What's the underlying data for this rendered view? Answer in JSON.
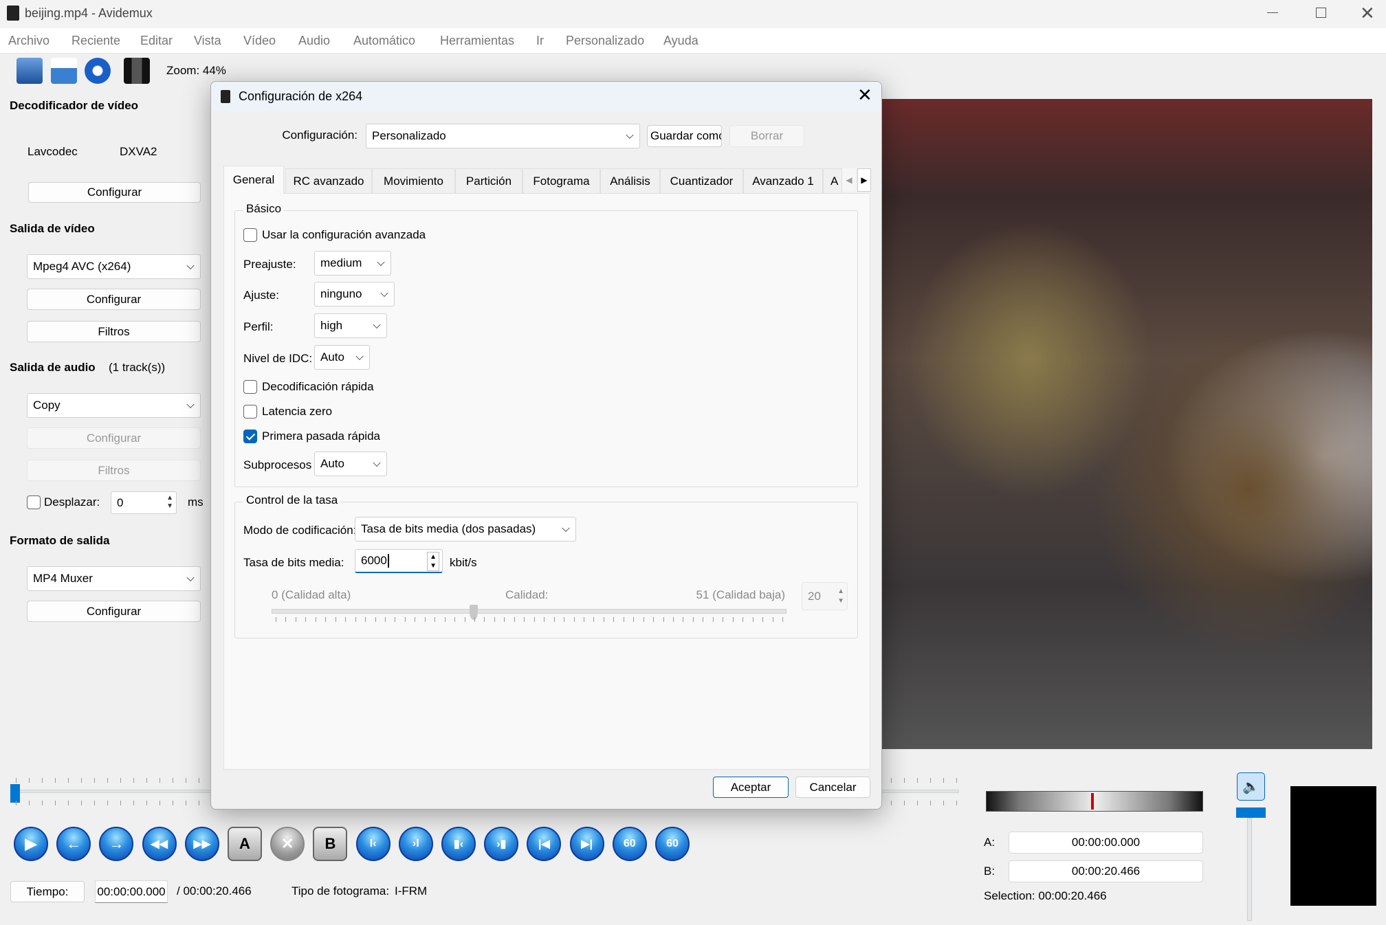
{
  "window": {
    "title": "beijing.mp4 - Avidemux"
  },
  "menu": [
    "Archivo",
    "Reciente",
    "Editar",
    "Vista",
    "Vídeo",
    "Audio",
    "Automático",
    "Herramientas",
    "Ir",
    "Personalizado",
    "Ayuda"
  ],
  "toolbar": {
    "zoom": "Zoom: 44%",
    "icons": [
      "open-file-icon",
      "save-file-icon",
      "info-icon",
      "filter-film-icon"
    ]
  },
  "left": {
    "video_decoder": {
      "title": "Decodificador de vídeo",
      "decoder": "Lavcodec",
      "accel": "DXVA2",
      "configure": "Configurar"
    },
    "video_output": {
      "title": "Salida de vídeo",
      "codec": "Mpeg4 AVC (x264)",
      "configure": "Configurar",
      "filters": "Filtros"
    },
    "audio_output": {
      "title": "Salida de audio",
      "tracks": "(1 track(s))",
      "codec": "Copy",
      "configure": "Configurar",
      "filters": "Filtros",
      "shift_label": "Desplazar:",
      "shift_value": "0",
      "shift_unit": "ms",
      "shift_checked": false
    },
    "output_format": {
      "title": "Formato de salida",
      "muxer": "MP4 Muxer",
      "configure": "Configurar"
    }
  },
  "dialog": {
    "title": "Configuración de x264",
    "config_label": "Configuración:",
    "config_value": "Personalizado",
    "save_as": "Guardar comc",
    "delete": "Borrar",
    "tabs": [
      "General",
      "RC avanzado",
      "Movimiento",
      "Partición",
      "Fotograma",
      "Análisis",
      "Cuantizador",
      "Avanzado 1",
      "A"
    ],
    "active_tab": "General",
    "basic": {
      "legend": "Básico",
      "use_advanced": "Usar la configuración avanzada",
      "preset_label": "Preajuste:",
      "preset": "medium",
      "tune_label": "Ajuste:",
      "tune": "ninguno",
      "profile_label": "Perfil:",
      "profile": "high",
      "idc_label": "Nivel de IDC:",
      "idc": "Auto",
      "fast_decode": "Decodificación rápida",
      "zero_latency": "Latencia zero",
      "fast_first_pass": "Primera pasada rápida",
      "threads_label": "Subprocesos",
      "threads": "Auto",
      "checks": {
        "use_advanced": false,
        "fast_decode": false,
        "zero_latency": false,
        "fast_first_pass": true
      }
    },
    "rate": {
      "legend": "Control de la tasa",
      "mode_label": "Modo de codificación:",
      "mode": "Tasa de bits media (dos pasadas)",
      "bitrate_label": "Tasa de bits media:",
      "bitrate": "6000",
      "bitrate_unit": "kbit/s",
      "q_min_label": "0 (Calidad alta)",
      "q_label": "Calidad:",
      "q_max_label": "51 (Calidad baja)",
      "quality": 20,
      "quality_display": "20",
      "quality_min": 0,
      "quality_max": 51
    },
    "ok": "Aceptar",
    "cancel": "Cancelar"
  },
  "bottom": {
    "time_button": "Tiempo:",
    "time": "00:00:00.000",
    "duration": "/ 00:00:20.466",
    "frame_type_label": "Tipo de fotograma:",
    "frame_type": "I-FRM",
    "position_fraction": 0,
    "playback_buttons": [
      "play",
      "previous-frame",
      "next-frame",
      "rewind",
      "fast-forward",
      "set-marker-a",
      "delete",
      "set-marker-b",
      "go-marker-a",
      "go-marker-b",
      "previous-keyframe",
      "next-keyframe",
      "first-frame",
      "last-frame",
      "back-60",
      "forward-60"
    ],
    "a_label": "A:",
    "a_value": "00:00:00.000",
    "b_label": "B:",
    "b_value": "00:00:20.466",
    "selection": "Selection: 00:00:20.466",
    "volume_level": 1
  },
  "colors": {
    "accent": "#0078d4",
    "jog_marker": "#cc0000"
  }
}
